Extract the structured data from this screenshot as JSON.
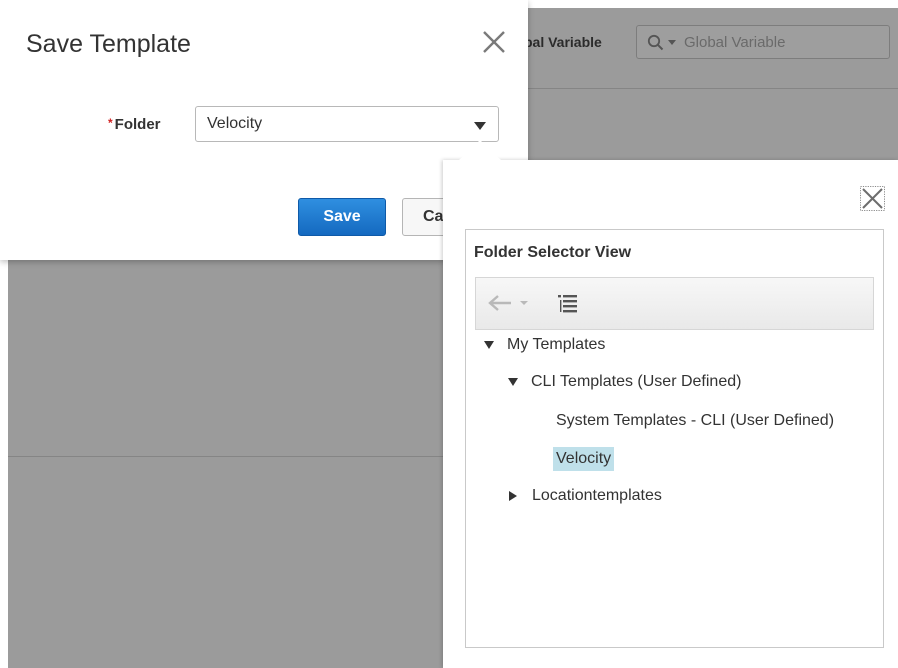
{
  "background": {
    "toolbar_label": "bal Variable",
    "search_placeholder": "Global Variable"
  },
  "dialog": {
    "title": "Save Template",
    "folder_label": "Folder",
    "required_marker": "*",
    "folder_value": "Velocity",
    "save_label": "Save",
    "cancel_label": "Ca"
  },
  "popup": {
    "title": "Folder Selector View",
    "tree": {
      "my_templates": "My Templates",
      "cli_templates": "CLI Templates (User Defined)",
      "system_templates": "System Templates - CLI (User Defined)",
      "velocity": "Velocity",
      "location_templates": "Locationtemplates"
    }
  },
  "colors": {
    "primary_button": "#1f7bd4",
    "selection": "#bfe0ea",
    "required": "#d21f1f",
    "overlay": "#9b9b9b"
  },
  "icons": {
    "dialog_close": "close-icon",
    "popup_close": "close-icon",
    "back": "back-arrow-icon",
    "list": "tree-list-icon",
    "search": "search-icon"
  }
}
